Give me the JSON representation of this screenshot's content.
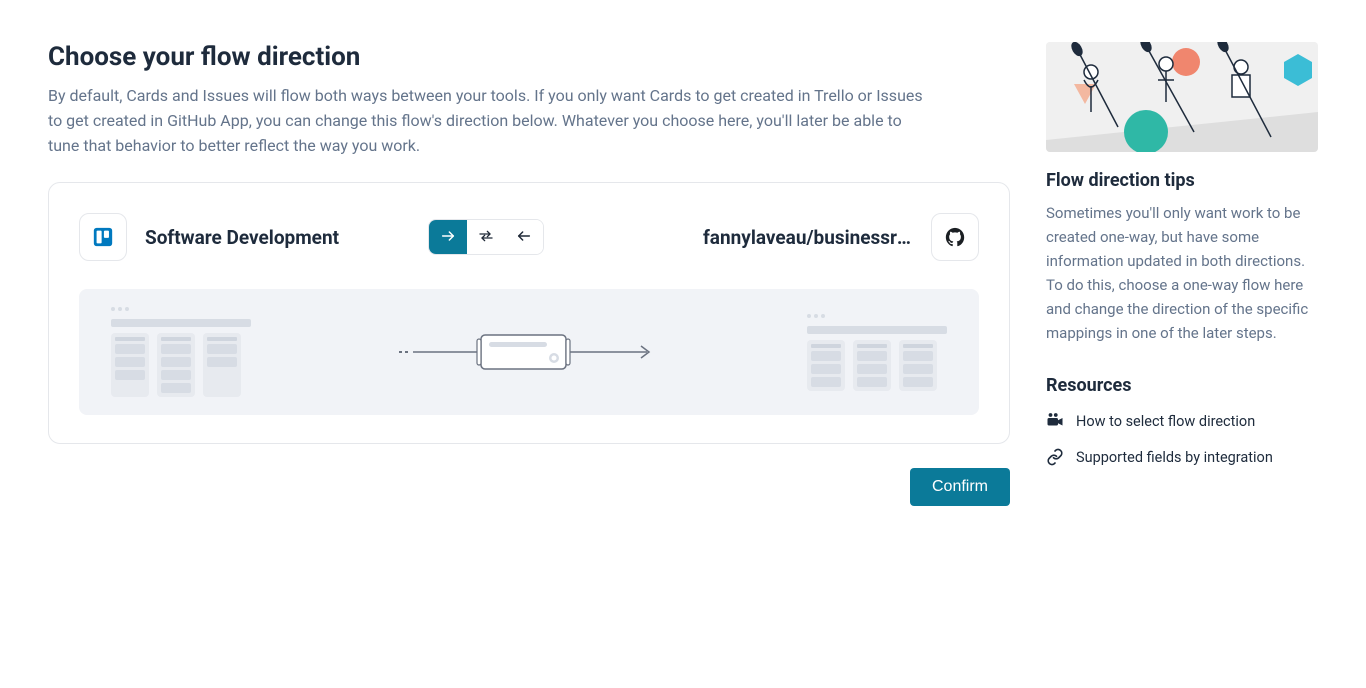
{
  "header": {
    "title": "Choose your flow direction",
    "description": "By default, Cards and Issues will flow both ways between your tools. If you only want Cards to get created in Trello or Issues to get created in GitHub App, you can change this flow's direction below. Whatever you choose here, you'll later be able to tune that behavior to better reflect the way you work."
  },
  "flow": {
    "source_label": "Software Development",
    "source_icon": "trello-icon",
    "target_label": "fannylaveau/businessre…",
    "target_icon": "github-icon",
    "direction": {
      "options": [
        "right",
        "both",
        "left"
      ],
      "active": "right"
    }
  },
  "actions": {
    "confirm_label": "Confirm"
  },
  "sidebar": {
    "tips_title": "Flow direction tips",
    "tips_text": "Sometimes you'll only want work to be created one-way, but have some information updated in both directions. To do this, choose a one-way flow here and change the direction of the specific mappings in one of the later steps.",
    "resources_title": "Resources",
    "resources": [
      {
        "icon": "video-icon",
        "label": "How to select flow direction"
      },
      {
        "icon": "link-icon",
        "label": "Supported fields by integration"
      }
    ]
  }
}
